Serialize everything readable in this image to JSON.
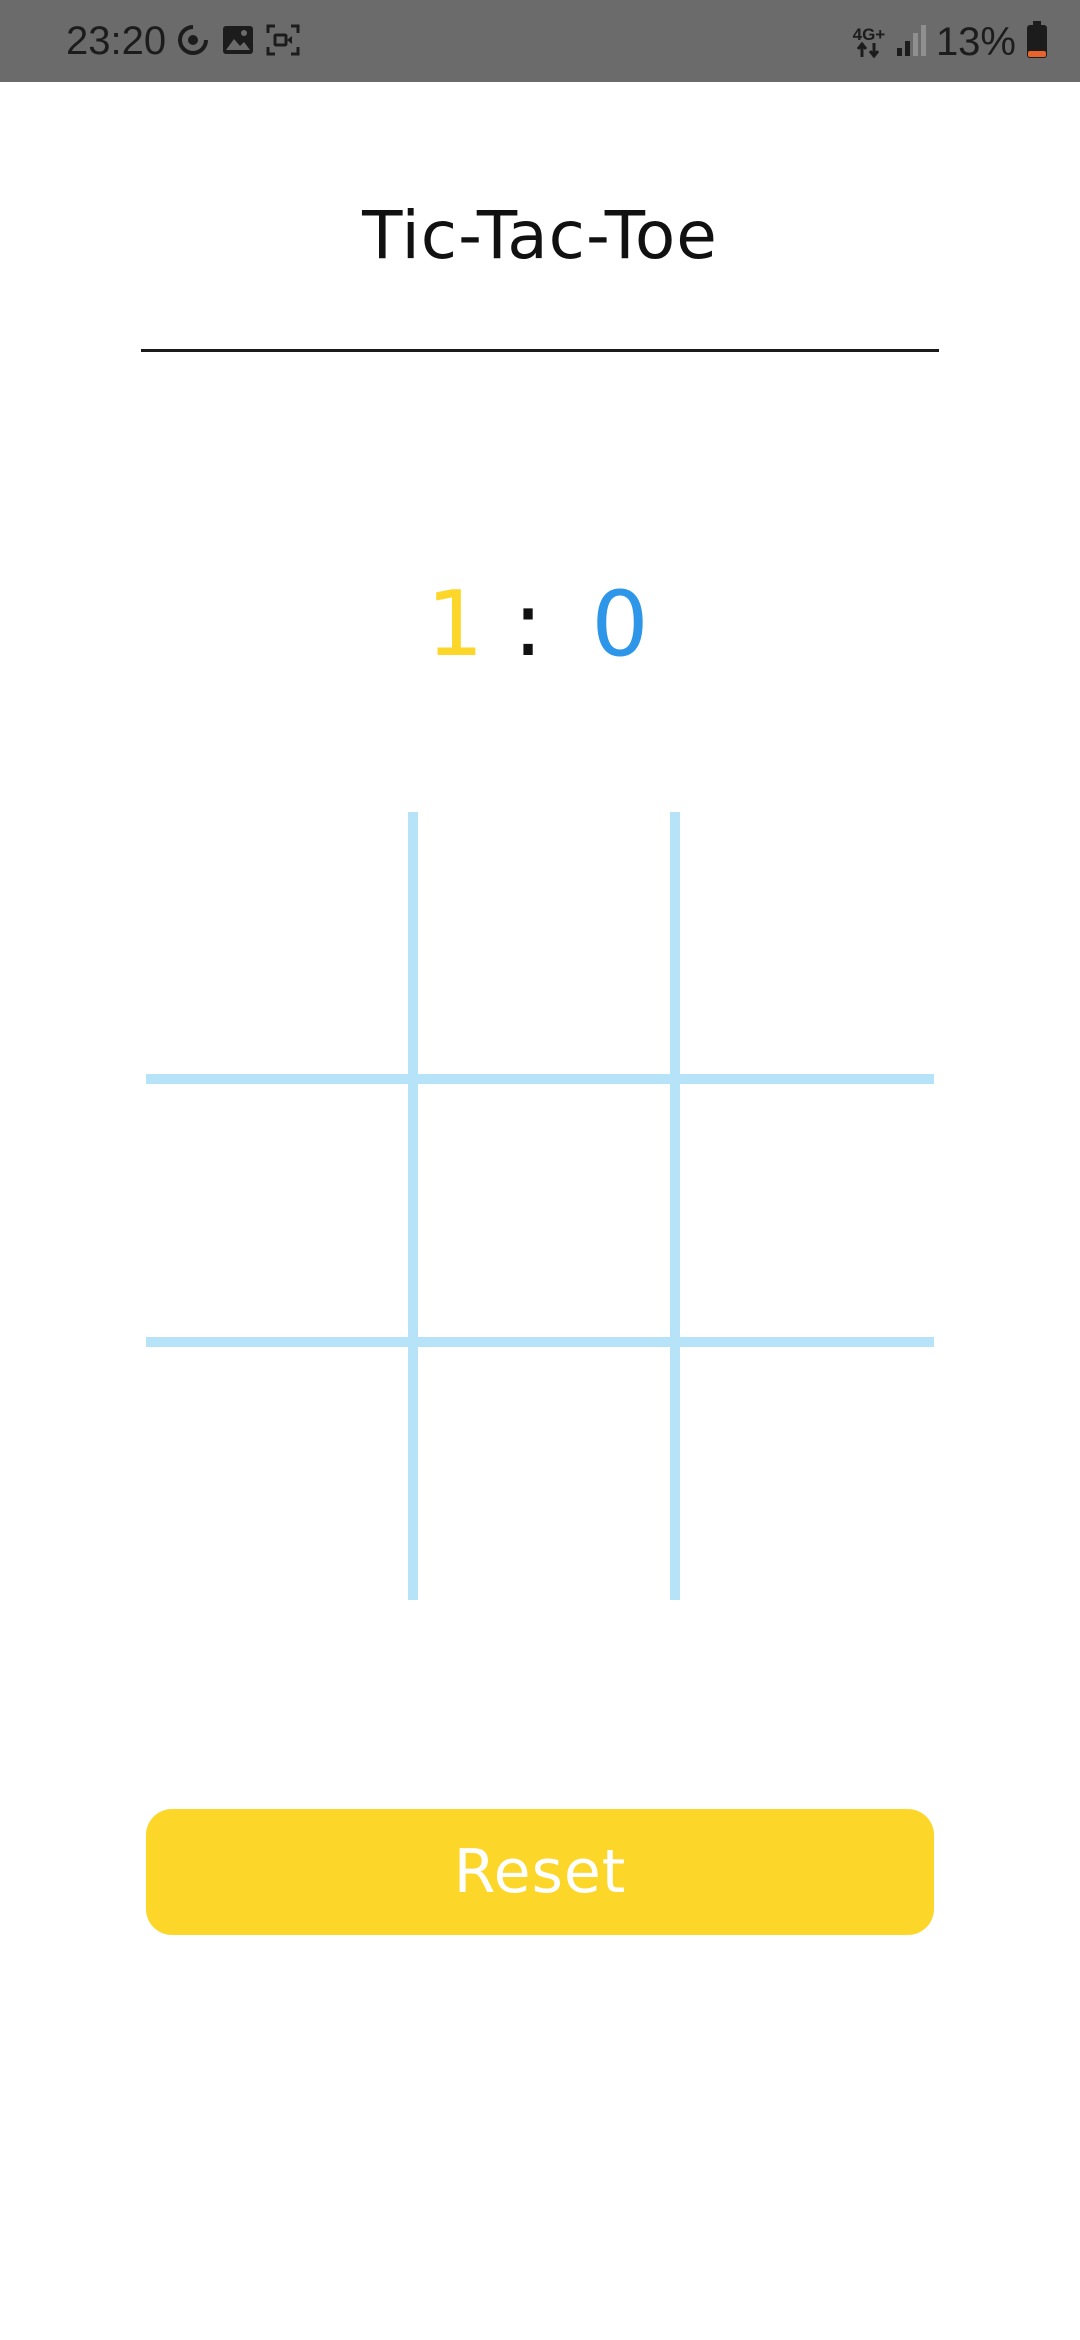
{
  "status_bar": {
    "time": "23:20",
    "network_type": "4G+",
    "battery_percent": "13%",
    "icons_left": [
      "sync-icon",
      "image-icon",
      "screen-record-icon"
    ],
    "icons_right": [
      "network-data-icon",
      "signal-icon",
      "battery-icon"
    ]
  },
  "app": {
    "title": "Tic-Tac-Toe"
  },
  "score": {
    "player_x": "1",
    "separator": ":",
    "player_o": "0"
  },
  "board": {
    "cells": [
      "",
      "",
      "",
      "",
      "",
      "",
      "",
      "",
      ""
    ]
  },
  "reset": {
    "label": "Reset"
  },
  "colors": {
    "status_bar": "#6b6b6b",
    "player_x": "#FDD62A",
    "player_o": "#2D96E8",
    "grid": "#B7E3F8",
    "reset_button": "#FDD62A",
    "divider": "#1a1a1a"
  }
}
